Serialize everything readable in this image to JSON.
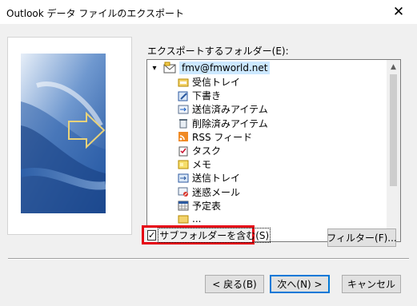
{
  "window": {
    "title": "Outlook データ ファイルのエクスポート",
    "close_glyph": "✕"
  },
  "folder_label": "エクスポートするフォルダー(E):",
  "tree": {
    "root": {
      "label": "fmv@fmworld.net",
      "expander": "▾"
    },
    "items": [
      {
        "label": "受信トレイ",
        "icon": "inbox-icon"
      },
      {
        "label": "下書き",
        "icon": "drafts-icon"
      },
      {
        "label": "送信済みアイテム",
        "icon": "sent-items-icon"
      },
      {
        "label": "削除済みアイテム",
        "icon": "deleted-items-icon"
      },
      {
        "label": "RSS フィード",
        "icon": "rss-icon"
      },
      {
        "label": "タスク",
        "icon": "tasks-icon"
      },
      {
        "label": "メモ",
        "icon": "notes-icon"
      },
      {
        "label": "送信トレイ",
        "icon": "outbox-icon"
      },
      {
        "label": "迷惑メール",
        "icon": "junk-mail-icon"
      },
      {
        "label": "予定表",
        "icon": "calendar-icon"
      },
      {
        "label": "...",
        "icon": "folder-icon"
      }
    ]
  },
  "subfolder": {
    "label": "サブフォルダーを含む(S)",
    "checked": true
  },
  "buttons": {
    "filter": "フィルター(F)...",
    "back": "< 戻る(B)",
    "next": "次へ(N) >",
    "cancel": "キャンセル"
  },
  "colors": {
    "highlight": "#cce8ff",
    "callout": "#e60012",
    "default_button_border": "#0078d7"
  }
}
